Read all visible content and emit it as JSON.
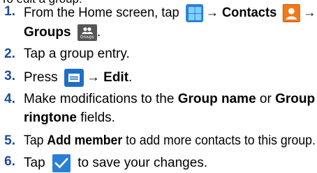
{
  "page": {
    "top_line": "To edit a group:",
    "steps": [
      {
        "number": "1.",
        "line1": {
          "prefix": "From the Home screen, tap",
          "arrow1": "→",
          "contacts_label": "Contacts",
          "arrow2": "→"
        },
        "line2": {
          "groups_label": "Groups",
          "groups_icon_caption": "Groups",
          "period": "."
        }
      },
      {
        "number": "2.",
        "text": "Tap a group entry."
      },
      {
        "number": "3.",
        "prefix": "Press",
        "arrow": "→",
        "edit_label": "Edit",
        "period": "."
      },
      {
        "number": "4.",
        "line1": {
          "prefix": "Make modifications to the",
          "field1": "Group name",
          "or": "or",
          "field2_part1": "Group"
        },
        "line2": {
          "field2_part2": "ringtone",
          "suffix": "fields."
        }
      },
      {
        "number": "5.",
        "prefix": "Tap",
        "add_label": "Add member",
        "suffix": "to add more contacts to this group."
      },
      {
        "number": "6.",
        "prefix": "Tap",
        "suffix": "to save your changes."
      }
    ]
  },
  "icons": {
    "apps": "apps-grid-icon",
    "contacts": "contacts-icon",
    "groups": "groups-icon",
    "menu": "menu-icon",
    "save": "checkmark-icon"
  },
  "colors": {
    "step_number": "#1a4b98",
    "icon_blue": "#2c7fd6",
    "contacts_orange": "#f07a1c"
  }
}
